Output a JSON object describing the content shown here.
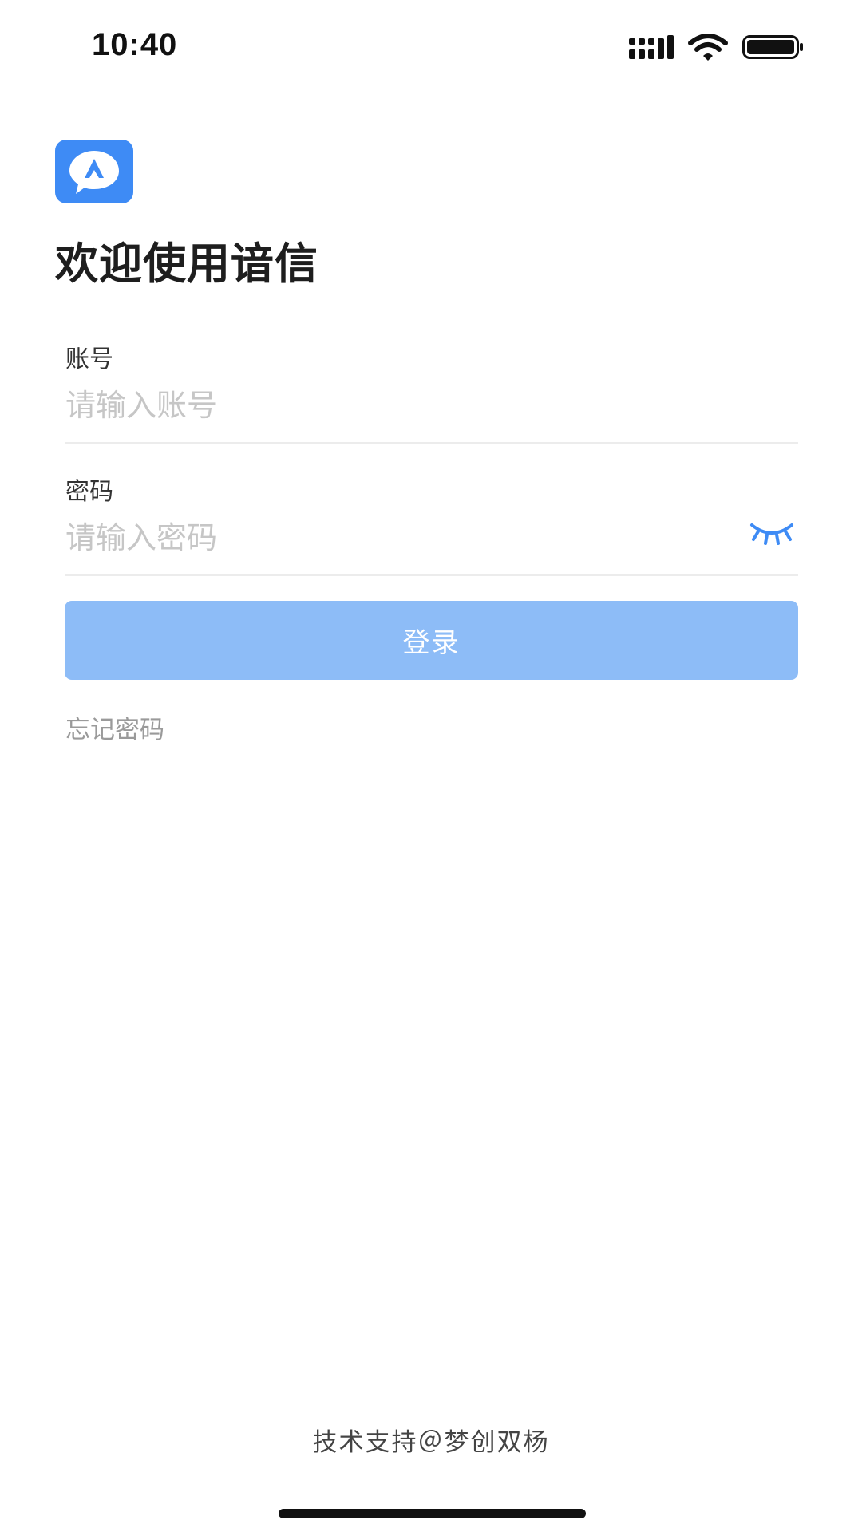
{
  "status_bar": {
    "time": "10:40",
    "icons": [
      "signal-icon",
      "wifi-icon",
      "battery-icon"
    ]
  },
  "app": {
    "logo_icon": "app-logo-icon",
    "brand_color": "#3e8bf5"
  },
  "welcome_title": "欢迎使用谙信",
  "account": {
    "label": "账号",
    "placeholder": "请输入账号",
    "value": ""
  },
  "password": {
    "label": "密码",
    "placeholder": "请输入密码",
    "value": "",
    "toggle_icon": "eye-closed-icon"
  },
  "login_button": {
    "label": "登录",
    "color": "#8dbcf7"
  },
  "forgot_password": "忘记密码",
  "footer": "技术支持＠梦创双杨"
}
